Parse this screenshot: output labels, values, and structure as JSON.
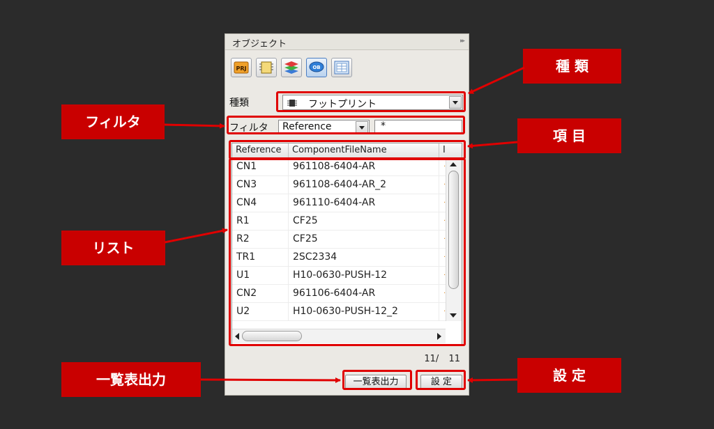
{
  "panel": {
    "title": "オブジェクト",
    "toolbar": [
      {
        "name": "prj-icon",
        "label": "PRJ"
      },
      {
        "name": "component-icon",
        "label": ""
      },
      {
        "name": "layers-icon",
        "label": ""
      },
      {
        "name": "ob-icon",
        "label": "OB"
      },
      {
        "name": "table-view-icon",
        "label": ""
      }
    ],
    "type_label": "種類",
    "type_value": "フットプリント",
    "filter_label": "フィルタ",
    "filter_field": "Reference",
    "filter_text": "*",
    "columns": [
      "Reference",
      "ComponentFileName",
      "I"
    ],
    "rows": [
      {
        "ref": "CN1",
        "file": "961108-6404-AR"
      },
      {
        "ref": "CN3",
        "file": "961108-6404-AR_2"
      },
      {
        "ref": "CN4",
        "file": "961110-6404-AR"
      },
      {
        "ref": "R1",
        "file": "CF25"
      },
      {
        "ref": "R2",
        "file": "CF25"
      },
      {
        "ref": "TR1",
        "file": "2SC2334"
      },
      {
        "ref": "U1",
        "file": "H10-0630-PUSH-12"
      },
      {
        "ref": "CN2",
        "file": "961106-6404-AR"
      },
      {
        "ref": "U2",
        "file": "H10-0630-PUSH-12_2"
      }
    ],
    "count": "11/ 11",
    "export_button": "一覧表出力",
    "settings_button": "設 定"
  },
  "callouts": {
    "type": "種 類",
    "filter": "フィルタ",
    "columns": "項 目",
    "list": "リスト",
    "export": "一覧表出力",
    "settings": "設 定"
  },
  "colors": {
    "callout_bg": "#c90000",
    "highlight": "#e00000",
    "background": "#2b2b2b",
    "panel_bg": "#ebe9e4"
  }
}
